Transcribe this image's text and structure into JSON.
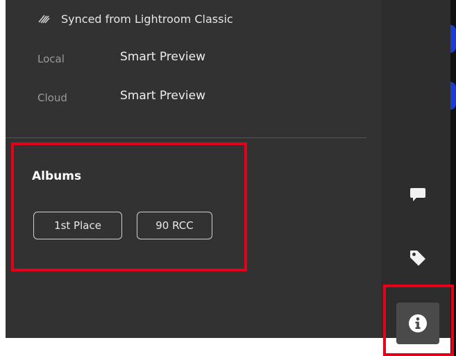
{
  "sync": {
    "icon": "sync-icon",
    "text": "Synced from Lightroom Classic"
  },
  "storage": [
    {
      "label": "Local",
      "value": "Smart Preview"
    },
    {
      "label": "Cloud",
      "value": "Smart Preview"
    }
  ],
  "albums": {
    "title": "Albums",
    "items": [
      {
        "label": "1st Place"
      },
      {
        "label": "90 RCC"
      }
    ]
  },
  "rail": {
    "icons": [
      "comment-icon",
      "tag-icon",
      "info-icon"
    ]
  },
  "colors": {
    "panel_bg": "#323232",
    "rail_bg": "#2d2d2d",
    "highlight": "#e6001a",
    "accent_blue": "#1c3bd0"
  }
}
